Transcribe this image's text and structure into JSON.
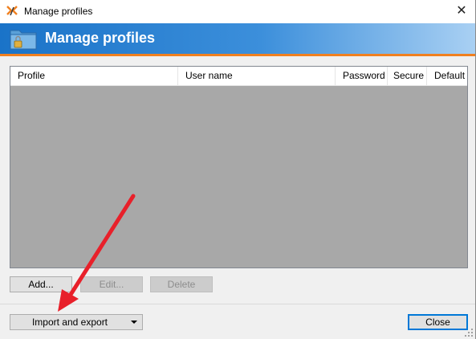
{
  "window": {
    "title": "Manage profiles",
    "close_glyph": "✕"
  },
  "banner": {
    "title": "Manage profiles",
    "icon": "folder-lock-icon"
  },
  "table": {
    "columns": [
      "Profile",
      "User name",
      "Password",
      "Secure",
      "Default"
    ],
    "rows": []
  },
  "buttons": {
    "add": "Add...",
    "edit": "Edit...",
    "delete": "Delete",
    "import_export": "Import and export",
    "close": "Close"
  },
  "colors": {
    "banner_start": "#1a73c8",
    "banner_end": "#a9d0f3",
    "accent_line": "#f08020",
    "annotation_arrow": "#e8202a"
  }
}
